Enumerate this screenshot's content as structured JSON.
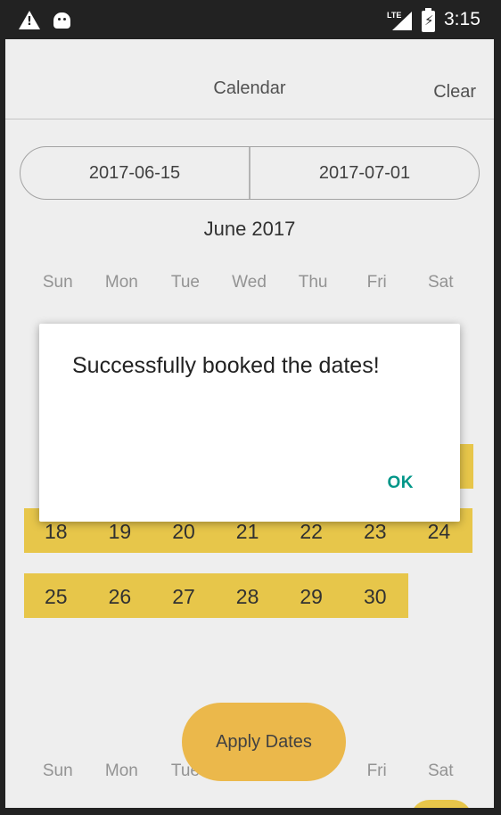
{
  "status_bar": {
    "network": "LTE",
    "time": "3:15",
    "warning_icon": "!",
    "battery_icon": "⚡"
  },
  "header": {
    "title": "Calendar",
    "clear_label": "Clear"
  },
  "date_range": {
    "start": "2017-06-15",
    "end": "2017-07-01"
  },
  "month": {
    "title": "June 2017",
    "weekdays": [
      "Sun",
      "Mon",
      "Tue",
      "Wed",
      "Thu",
      "Fri",
      "Sat"
    ],
    "weeks": [
      [
        "18",
        "19",
        "20",
        "21",
        "22",
        "23",
        "24"
      ],
      [
        "25",
        "26",
        "27",
        "28",
        "29",
        "30"
      ]
    ]
  },
  "apply_label": "Apply Dates",
  "next_month": {
    "weekdays": [
      "Sun",
      "Mon",
      "Tue",
      "Fri",
      "Sat"
    ]
  },
  "dialog": {
    "message": "Successfully booked the dates!",
    "ok_label": "OK",
    "accent": "#009688"
  },
  "colors": {
    "selected_range": "#f1cf4e",
    "apply_button": "#f5c04f"
  }
}
